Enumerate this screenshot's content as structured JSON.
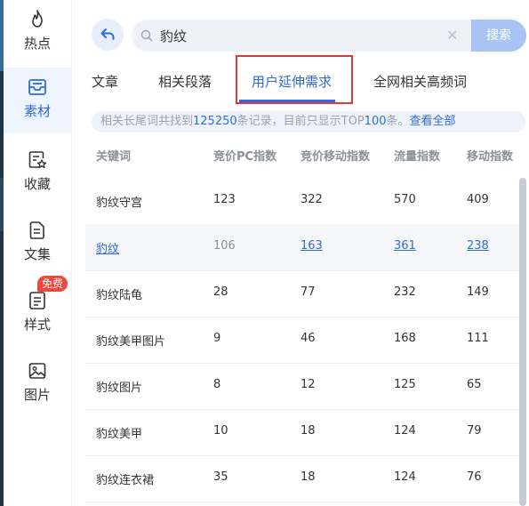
{
  "sidebar": {
    "items": [
      {
        "label": "热点",
        "icon": "flame-icon",
        "active": false
      },
      {
        "label": "素材",
        "icon": "inbox-icon",
        "active": true
      },
      {
        "label": "收藏",
        "icon": "collect-icon",
        "active": false
      },
      {
        "label": "文集",
        "icon": "document-icon",
        "active": false
      },
      {
        "label": "样式",
        "icon": "style-icon",
        "active": false,
        "badge": "免费"
      },
      {
        "label": "图片",
        "icon": "image-icon",
        "active": false
      }
    ]
  },
  "search": {
    "value": "豹纹",
    "button_label": "搜索"
  },
  "tabs": [
    {
      "label": "文章",
      "active": false
    },
    {
      "label": "相关段落",
      "active": false
    },
    {
      "label": "用户延伸需求",
      "active": true
    },
    {
      "label": "全网相关高频词",
      "active": false
    }
  ],
  "info": {
    "prefix": "相关长尾词共找到",
    "total": "125250",
    "middle": "条记录，目前只显示TOP",
    "shown": "100",
    "suffix": "条。",
    "link": "查看全部"
  },
  "table": {
    "headers": [
      "关键词",
      "竞价PC指数",
      "竞价移动指数",
      "流量指数",
      "移动指数"
    ],
    "rows": [
      [
        "豹纹守宫",
        "123",
        "322",
        "570",
        "409"
      ],
      [
        "豹纹",
        "106",
        "163",
        "361",
        "238"
      ],
      [
        "豹纹陆龟",
        "28",
        "77",
        "232",
        "149"
      ],
      [
        "豹纹美甲图片",
        "9",
        "46",
        "168",
        "111"
      ],
      [
        "豹纹图片",
        "8",
        "12",
        "125",
        "65"
      ],
      [
        "豹纹美甲",
        "10",
        "18",
        "124",
        "79"
      ],
      [
        "豹纹连衣裙",
        "35",
        "18",
        "124",
        "76"
      ]
    ]
  },
  "colors": {
    "accent": "#2f6bdc",
    "badge": "#f0473c",
    "highlight_box": "#e0373a"
  }
}
